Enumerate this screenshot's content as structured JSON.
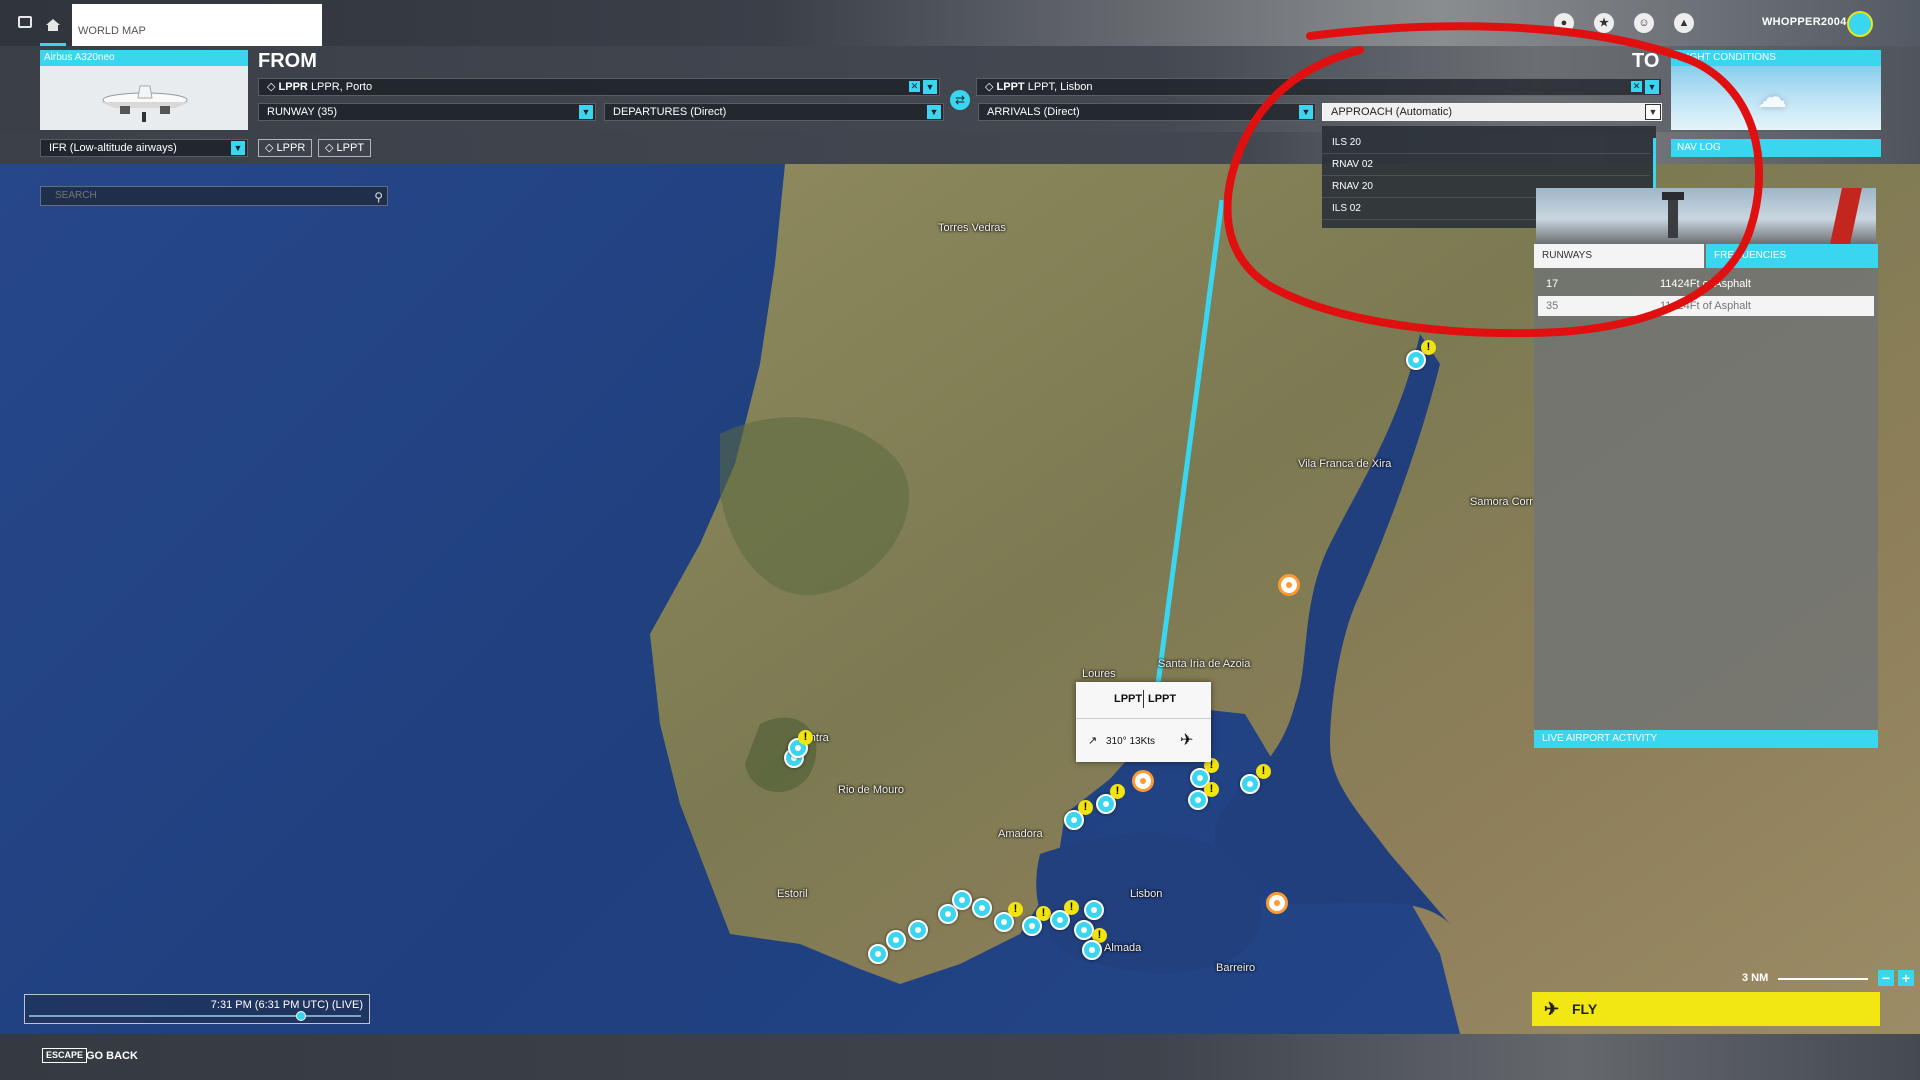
{
  "topbar": {
    "tab_label": "WORLD MAP",
    "username": "WHOPPER2004",
    "icons": [
      "menu-icon",
      "home-icon",
      "marketplace-icon",
      "achievements-icon",
      "profile-icon",
      "notifications-icon"
    ]
  },
  "aircraft": {
    "name": "Airbus A320neo"
  },
  "from": {
    "heading": "FROM",
    "airport_code": "LPPR",
    "airport_name": "LPPR, Porto",
    "runway": "RUNWAY (35)",
    "departure": "DEPARTURES (Direct)"
  },
  "to": {
    "heading": "TO",
    "airport_code": "LPPT",
    "airport_name": "LPPT, Lisbon",
    "arrival": "ARRIVALS (Direct)",
    "approach": "APPROACH (Automatic)"
  },
  "approach_options": [
    "ILS 20",
    "RNAV 02",
    "RNAV 20",
    "ILS 02"
  ],
  "flight_conditions": {
    "title": "FLIGHT CONDITIONS"
  },
  "route": {
    "type": "IFR (Low-altitude airways)",
    "chips": [
      "LPPR",
      "LPPT"
    ]
  },
  "nav_log": {
    "label": "NAV LOG"
  },
  "search": {
    "placeholder": "SEARCH"
  },
  "airport_panel": {
    "tabs": [
      "RUNWAYS",
      "FREQUENCIES"
    ],
    "runways": [
      {
        "id": "17",
        "desc": "11424Ft of Asphalt"
      },
      {
        "id": "35",
        "desc": "11424Ft of Asphalt"
      }
    ],
    "live_activity": "LIVE AIRPORT ACTIVITY"
  },
  "popup": {
    "code_left": "LPPT",
    "code_right": "LPPT",
    "wind": "310° 13Kts"
  },
  "map_labels": [
    "Torres Vedras",
    "Vila Franca de Xira",
    "Samora Corr",
    "Loures",
    "Santa Iria de Azoia",
    "Rio de Mouro",
    "Amadora",
    "Estoril",
    "Lisbon",
    "Almada",
    "Barreiro",
    "Sintra"
  ],
  "time": {
    "text": "7:31 PM (6:31 PM UTC) (LIVE)",
    "progress": 0.82
  },
  "scale": {
    "label": "3 NM"
  },
  "fly": {
    "label": "FLY"
  },
  "bottombar": {
    "escape_key": "ESCAPE",
    "go_back": "GO BACK"
  },
  "colors": {
    "accent": "#3ad6ef",
    "fly": "#f2e713",
    "annotation": "#e01010",
    "warning": "#f1e412"
  }
}
